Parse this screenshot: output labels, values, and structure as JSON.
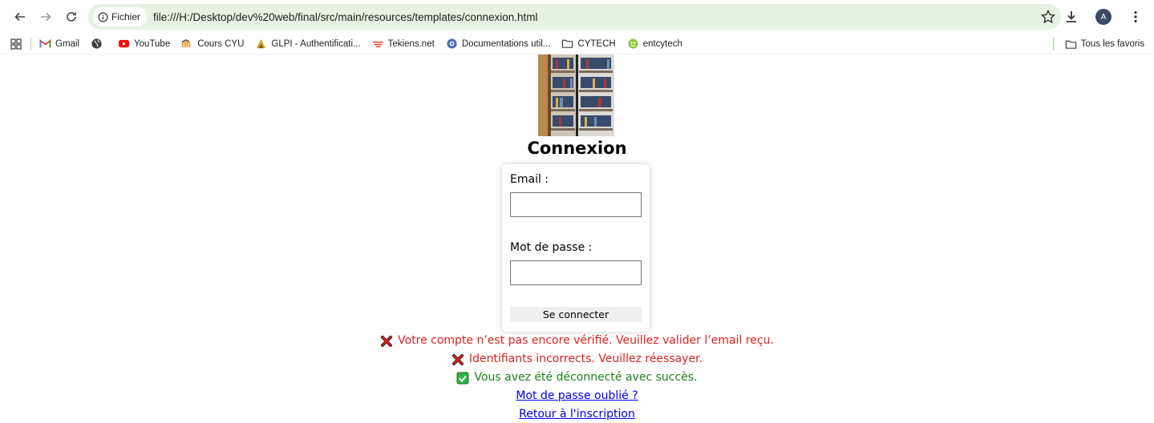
{
  "browser": {
    "site_chip": "Fichier",
    "url": "file:///H:/Desktop/dev%20web/final/src/main/resources/templates/connexion.html",
    "avatar_letter": "A"
  },
  "bookmarks": {
    "items": [
      {
        "label": "Gmail",
        "icon": "gmail-icon"
      },
      {
        "label": "",
        "icon": "globe-icon"
      },
      {
        "label": "YouTube",
        "icon": "youtube-icon"
      },
      {
        "label": "Cours CYU",
        "icon": "moodle-icon"
      },
      {
        "label": "GLPI - Authentificati...",
        "icon": "glpi-icon"
      },
      {
        "label": "Tekiens.net",
        "icon": "tekiens-icon"
      },
      {
        "label": "Documentations util...",
        "icon": "docs-icon"
      },
      {
        "label": "CYTECH",
        "icon": "folder-icon"
      },
      {
        "label": "entcytech",
        "icon": "ent-icon"
      }
    ],
    "all_bookmarks": "Tous les favoris"
  },
  "page": {
    "title": "Connexion",
    "email_label": "Email :",
    "email_value": "",
    "password_label": "Mot de passe :",
    "password_value": "",
    "submit_label": "Se connecter",
    "messages": {
      "unverified": "Votre compte n’est pas encore vérifié. Veuillez valider l’email reçu.",
      "bad_credentials": "Identifiants incorrects. Veuillez réessayer.",
      "logged_out": "Vous avez été déconnecté avec succès."
    },
    "forgot_link": "Mot de passe oublié ?",
    "signup_link": "Retour à l'inscription"
  },
  "colors": {
    "omnibox_bg": "#e7f3e2",
    "error": "#e02020",
    "success": "#1e7e1e",
    "link": "#0000ee"
  }
}
